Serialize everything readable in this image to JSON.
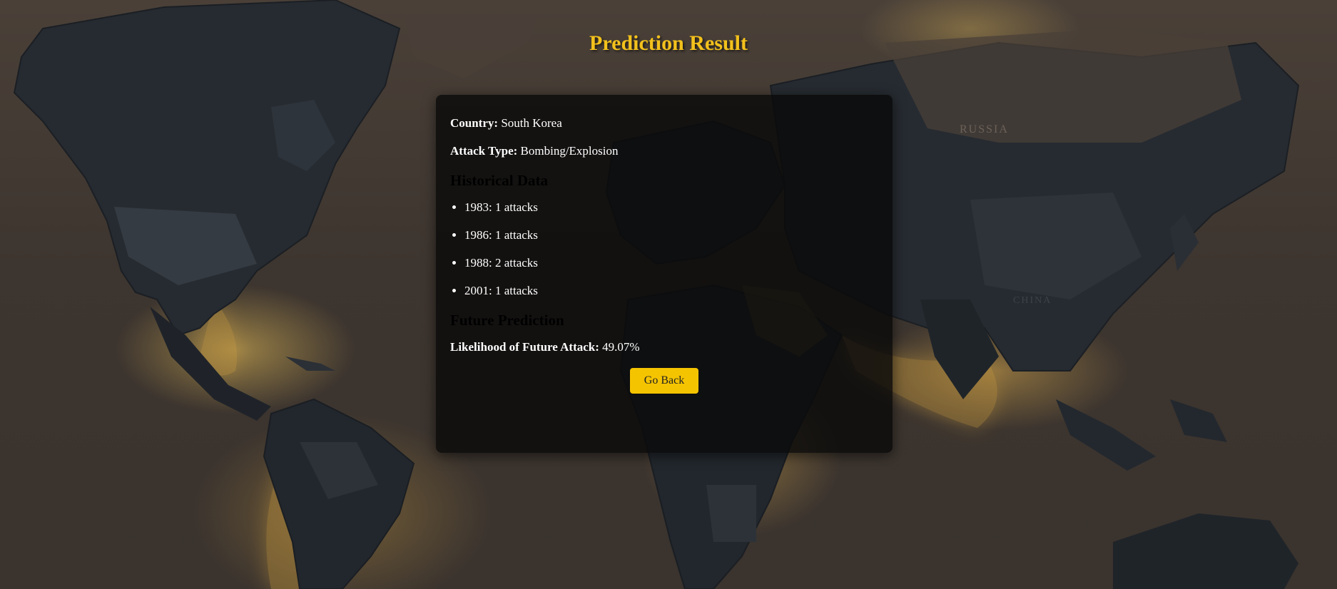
{
  "page": {
    "title": "Prediction Result"
  },
  "result": {
    "country_label": "Country:",
    "country_value": "South Korea",
    "attack_type_label": "Attack Type:",
    "attack_type_value": "Bombing/Explosion"
  },
  "history": {
    "heading": "Historical Data",
    "items": [
      "1983: 1 attacks",
      "1986: 1 attacks",
      "1988: 2 attacks",
      "2001: 1 attacks"
    ]
  },
  "prediction": {
    "heading": "Future Prediction",
    "likelihood_label": "Likelihood of Future Attack:",
    "likelihood_value": "49.07%"
  },
  "actions": {
    "back_label": "Go Back"
  },
  "background": {
    "map_labels": [
      "RUSSIA",
      "CHINA"
    ]
  },
  "colors": {
    "accent": "#f3c11c",
    "button": "#f5c400",
    "card_bg": "#0a0a0a",
    "continent": "#252a30",
    "backdrop": "#3d352f"
  }
}
